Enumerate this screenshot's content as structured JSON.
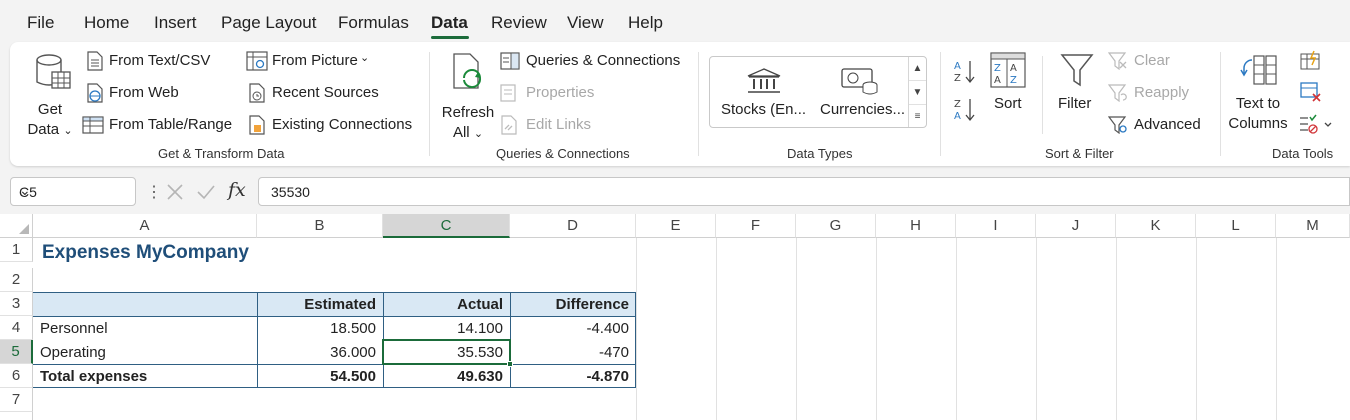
{
  "menu": {
    "tabs": [
      "File",
      "Home",
      "Insert",
      "Page Layout",
      "Formulas",
      "Data",
      "Review",
      "View",
      "Help"
    ],
    "active": "Data"
  },
  "ribbon": {
    "get_transform": {
      "get_data_line1": "Get",
      "get_data_line2": "Data",
      "from_text_csv": "From Text/CSV",
      "from_web": "From Web",
      "from_table_range": "From Table/Range",
      "from_picture": "From Picture",
      "recent_sources": "Recent Sources",
      "existing_connections": "Existing Connections",
      "label": "Get & Transform Data"
    },
    "queries": {
      "refresh_line1": "Refresh",
      "refresh_line2": "All",
      "queries_connections": "Queries & Connections",
      "properties": "Properties",
      "edit_links": "Edit Links",
      "label": "Queries & Connections"
    },
    "data_types": {
      "stocks": "Stocks (En...",
      "currencies": "Currencies...",
      "label": "Data Types"
    },
    "sort_filter": {
      "sort": "Sort",
      "filter": "Filter",
      "clear": "Clear",
      "reapply": "Reapply",
      "advanced": "Advanced",
      "label": "Sort & Filter"
    },
    "data_tools": {
      "text_to_line1": "Text to",
      "text_to_line2": "Columns",
      "label": "Data Tools"
    }
  },
  "formula_bar": {
    "name_box": "C5",
    "fx": "fx",
    "value": "35530"
  },
  "sheet": {
    "columns": [
      "A",
      "B",
      "C",
      "D",
      "E",
      "F",
      "G",
      "H",
      "I",
      "J",
      "K",
      "L",
      "M"
    ],
    "rows": [
      "1",
      "2",
      "3",
      "4",
      "5",
      "6",
      "7"
    ],
    "title": "Expenses MyCompany",
    "headers": [
      "",
      "Estimated",
      "Actual",
      "Difference"
    ],
    "data": [
      [
        "Personnel",
        "18.500",
        "14.100",
        "-4.400"
      ],
      [
        "Operating",
        "36.000",
        "35.530",
        "-470"
      ],
      [
        "Total expenses",
        "54.500",
        "49.630",
        "-4.870"
      ]
    ],
    "selected_cell": "C5"
  },
  "colors": {
    "accent": "#1b6b3a",
    "title": "#1f4e79",
    "table_header_fill": "#d9e8f4",
    "table_border": "#2f5f83"
  }
}
